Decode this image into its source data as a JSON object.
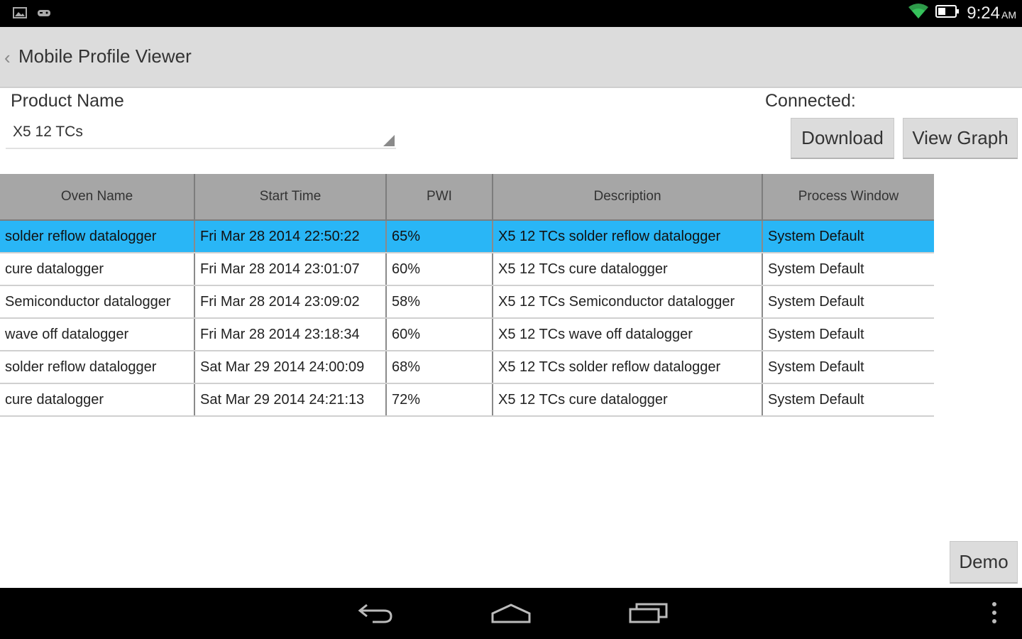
{
  "status_bar": {
    "left_icons": [
      "gallery-icon",
      "game-controller-icon"
    ],
    "right_icons": [
      "wifi-icon",
      "battery-icon"
    ],
    "time": "9:24",
    "ampm": "AM"
  },
  "app": {
    "title": "Mobile Profile Viewer",
    "back_icon": "chevron-left-icon"
  },
  "product": {
    "label": "Product Name",
    "selected": "X5 12 TCs"
  },
  "connection": {
    "label": "Connected:"
  },
  "buttons": {
    "download": "Download",
    "view_graph": "View Graph",
    "demo": "Demo"
  },
  "table": {
    "columns": [
      "Oven Name",
      "Start Time",
      "PWI",
      "Description",
      "Process Window"
    ],
    "rows": [
      {
        "oven": "solder reflow datalogger",
        "start": "Fri Mar 28 2014 22:50:22",
        "pwi": "65%",
        "desc": "X5 12 TCs solder reflow datalogger",
        "window": "System Default",
        "selected": true
      },
      {
        "oven": "cure datalogger",
        "start": "Fri Mar 28 2014 23:01:07",
        "pwi": "60%",
        "desc": "X5 12 TCs cure datalogger",
        "window": "System Default",
        "selected": false
      },
      {
        "oven": "Semiconductor datalogger",
        "start": "Fri Mar 28 2014 23:09:02",
        "pwi": "58%",
        "desc": "X5 12 TCs Semiconductor datalogger",
        "window": "System Default",
        "selected": false
      },
      {
        "oven": "wave off datalogger",
        "start": "Fri Mar 28 2014 23:18:34",
        "pwi": "60%",
        "desc": "X5 12 TCs wave off datalogger",
        "window": "System Default",
        "selected": false
      },
      {
        "oven": "solder reflow datalogger",
        "start": "Sat Mar 29 2014 24:00:09",
        "pwi": "68%",
        "desc": "X5 12 TCs solder reflow datalogger",
        "window": "System Default",
        "selected": false
      },
      {
        "oven": "cure datalogger",
        "start": "Sat Mar 29 2014 24:21:13",
        "pwi": "72%",
        "desc": "X5 12 TCs cure datalogger",
        "window": "System Default",
        "selected": false
      }
    ]
  },
  "nav_bar": {
    "icons": [
      "back-icon",
      "home-icon",
      "recent-apps-icon",
      "overflow-menu-icon"
    ]
  },
  "colors": {
    "selection": "#29b6f6",
    "header_bg": "#a6a6a6",
    "action_bar": "#dcdcdc"
  }
}
